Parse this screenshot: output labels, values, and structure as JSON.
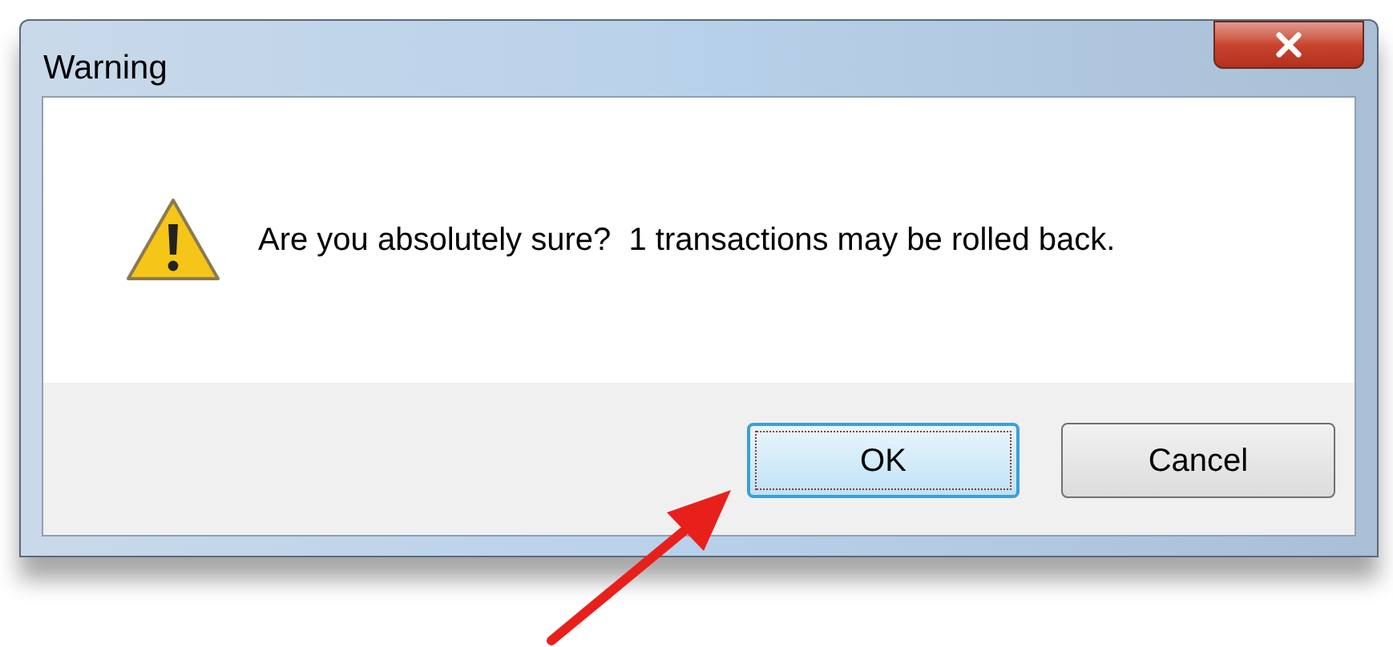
{
  "window": {
    "title": "Warning"
  },
  "message": "Are you absolutely sure?  1 transactions may be rolled back.",
  "buttons": [
    {
      "label": "OK",
      "focused": true
    },
    {
      "label": "Cancel",
      "focused": false
    }
  ]
}
